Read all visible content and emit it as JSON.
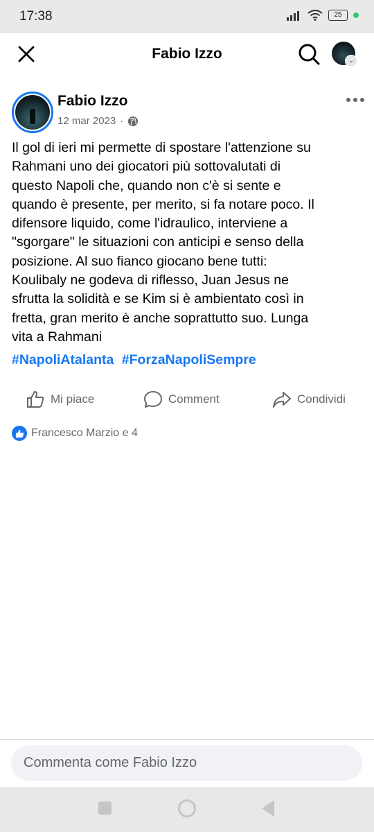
{
  "status_bar": {
    "time": "17:38",
    "battery": "25",
    "icons": [
      "signal-icon",
      "wifi-icon",
      "battery-icon",
      "dot-icon"
    ]
  },
  "header": {
    "title": "Fabio Izzo",
    "icons": [
      "close-icon",
      "search-icon",
      "avatar-icon",
      "chevron-down-icon"
    ]
  },
  "post": {
    "author": "Fabio Izzo",
    "date": "12 mar 2023",
    "separator": "·",
    "privacy_icon": "globe-icon",
    "lines": [
      "Il gol di ieri mi permette di spostare l'attenzione su",
      "Rahmani  uno dei giocatori più sottovalutati di",
      "questo Napoli che, quando non c'è si sente e",
      "quando è presente, per merito, si fa notare poco. Il",
      "difensore liquido, come l'idraulico, interviene a",
      "\"sgorgare\" le situazioni con anticipi e senso della",
      "posizione. Al suo fianco giocano bene tutti:",
      "Koulibaly ne godeva di riflesso, Juan Jesus ne",
      "sfrutta la solidità e se Kim si è ambientato così in",
      "fretta, gran merito è anche soprattutto suo. Lunga",
      "vita a Rahmani"
    ],
    "hashtags": [
      "#NapoliAtalanta",
      "#ForzaNapoliSempre"
    ]
  },
  "actions": {
    "like": "Mi piace",
    "comment": "Comment",
    "share": "Condividi"
  },
  "reactions": {
    "text": "Francesco Marzio e 4",
    "color": "#1877f2"
  },
  "comment_input": {
    "placeholder": "Commenta come Fabio Izzo"
  },
  "colors": {
    "accent": "#1877f2",
    "secondary_text": "#65676b"
  }
}
